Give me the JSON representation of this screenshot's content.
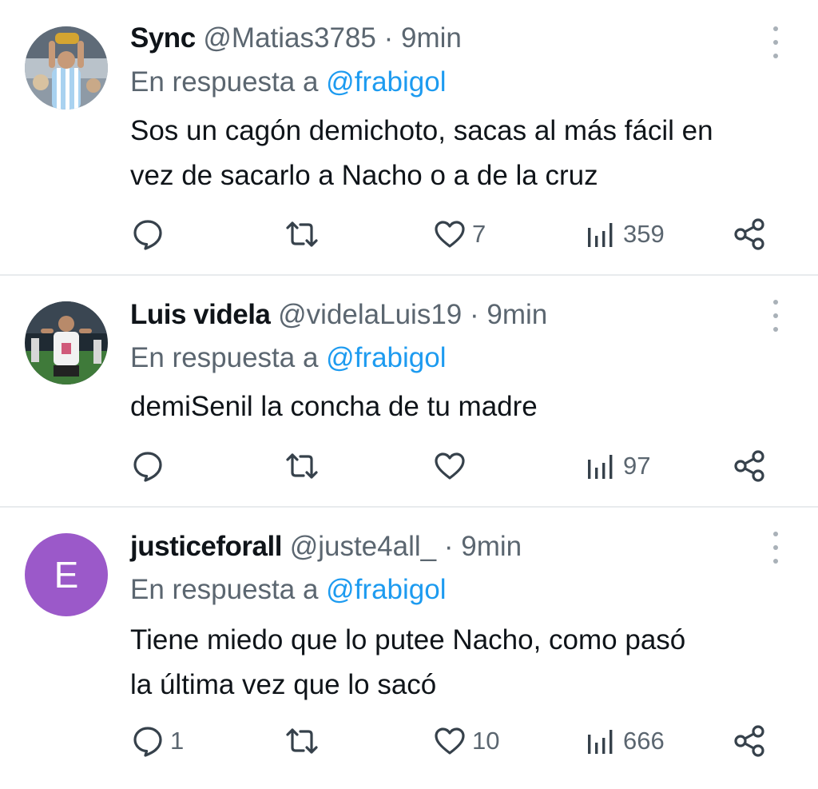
{
  "tweets": [
    {
      "name": "Sync",
      "handle": "@Matias3785",
      "separator": "·",
      "time": "9min",
      "reply_prefix": "En respuesta a",
      "reply_to": "@frabigol",
      "text_lines": [
        "Sos un cagón demichoto, sacas al más fácil en",
        "vez de sacarlo a Nacho o a de la cruz"
      ],
      "replies": "",
      "retweets": "",
      "likes": "7",
      "views": "359",
      "avatar": "photo"
    },
    {
      "name": "Luis videla",
      "handle": "@videlaLuis19",
      "separator": "·",
      "time": "9min",
      "reply_prefix": "En respuesta a",
      "reply_to": "@frabigol",
      "text_lines": [
        "demiSenil la concha de tu madre"
      ],
      "replies": "",
      "retweets": "",
      "likes": "",
      "views": "97",
      "avatar": "photo"
    },
    {
      "name": "justiceforall",
      "handle": "@juste4all_",
      "separator": "·",
      "time": "9min",
      "reply_prefix": "En respuesta a",
      "reply_to": "@frabigol",
      "text_lines": [
        "Tiene miedo que lo putee Nacho, como pasó",
        "la última vez que lo sacó"
      ],
      "replies": "1",
      "retweets": "",
      "likes": "10",
      "views": "666",
      "avatar": "letter",
      "avatar_letter": "E",
      "avatar_color": "#9b59c9"
    }
  ],
  "icons": {
    "reply": "reply-icon",
    "retweet": "retweet-icon",
    "like": "heart-icon",
    "views": "views-icon",
    "share": "share-icon",
    "more": "more-icon"
  },
  "colors": {
    "accent": "#1d9bf0",
    "muted": "#5b6670",
    "text": "#0f1419"
  }
}
